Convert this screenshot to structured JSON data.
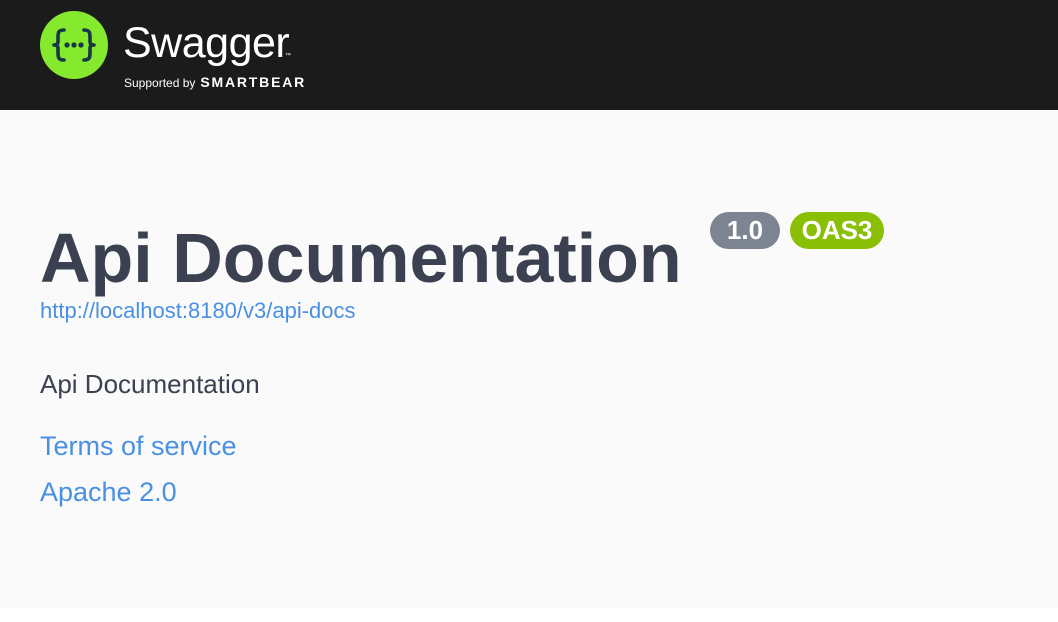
{
  "topbar": {
    "brand_name": "Swagger",
    "trademark": "™",
    "supported_by": "Supported by",
    "sponsor": "SMARTBEAR",
    "logo_glyph": "{···}",
    "colors": {
      "background": "#1b1b1b",
      "logo_green": "#85ea2d",
      "logo_dark": "#173647"
    }
  },
  "info": {
    "title": "Api Documentation",
    "version_badge": "1.0",
    "spec_badge": "OAS3",
    "spec_url": "http://localhost:8180/v3/api-docs",
    "description": "Api Documentation",
    "terms_of_service": "Terms of service",
    "license": "Apache 2.0",
    "colors": {
      "title": "#3b4151",
      "link": "#4990e2",
      "version_badge": "#7d8492",
      "spec_badge": "#89bf04",
      "background": "#fafafa"
    }
  }
}
